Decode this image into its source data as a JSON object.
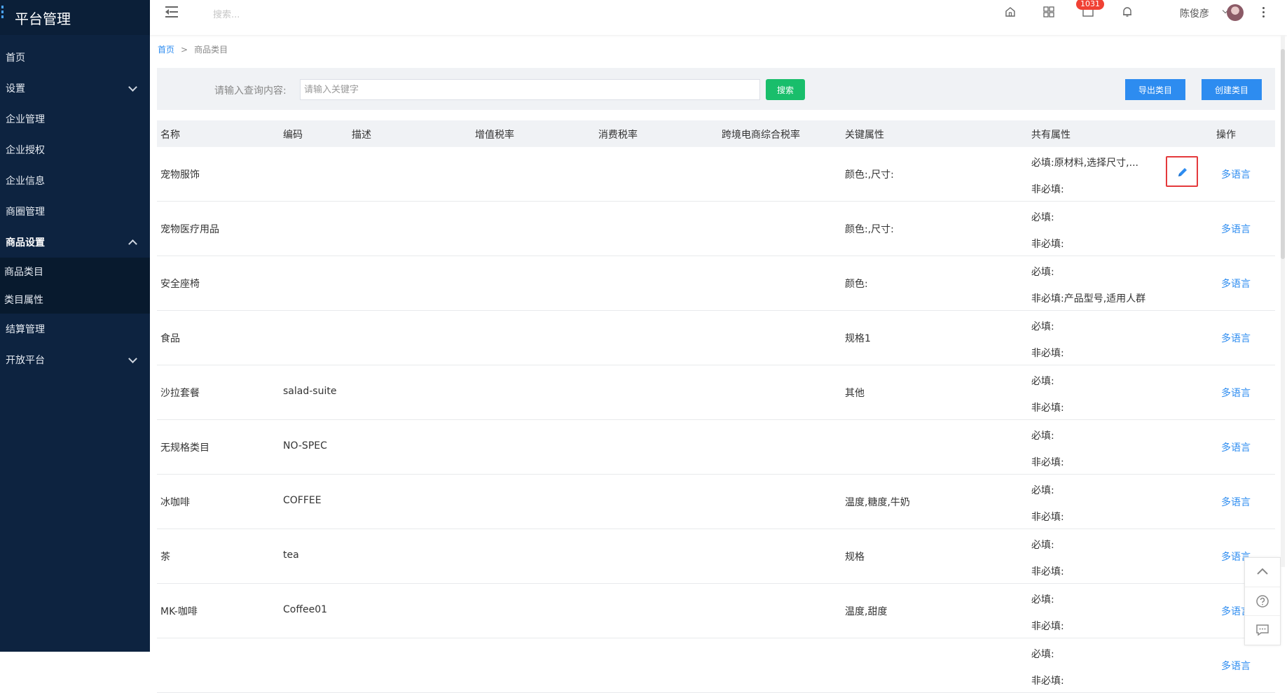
{
  "app": {
    "title": "平台管理"
  },
  "sidebar": {
    "items": [
      {
        "label": "首页"
      },
      {
        "label": "设置"
      },
      {
        "label": "企业管理"
      },
      {
        "label": "企业授权"
      },
      {
        "label": "企业信息"
      },
      {
        "label": "商圈管理"
      },
      {
        "label": "商品设置"
      },
      {
        "label": "结算管理"
      },
      {
        "label": "开放平台"
      }
    ],
    "sub_items": [
      {
        "label": "商品类目"
      },
      {
        "label": "类目属性"
      }
    ]
  },
  "topbar": {
    "search_placeholder": "搜索...",
    "badge_count": "1031",
    "user_name": "陈俊彦"
  },
  "breadcrumb": {
    "home": "首页",
    "separator": ">",
    "current": "商品类目"
  },
  "filter": {
    "label": "请输入查询内容:",
    "placeholder": "请输入关键字",
    "search_label": "搜索",
    "export_label": "导出类目",
    "create_label": "创建类目"
  },
  "table": {
    "headers": {
      "name": "名称",
      "code": "编码",
      "desc": "描述",
      "vat": "增值税率",
      "consumption": "消费税率",
      "crossborder": "跨境电商综合税率",
      "key_attr": "关键属性",
      "shared_attr": "共有属性",
      "action": "操作"
    },
    "required_label": "必填:",
    "optional_label": "非必填:",
    "action_label": "多语言",
    "rows": [
      {
        "name": "宠物服饰",
        "code": "",
        "key_attr": "颜色:,尺寸:",
        "required": "原材料,选择尺寸,...",
        "optional": ""
      },
      {
        "name": "宠物医疗用品",
        "code": "",
        "key_attr": "颜色:,尺寸:",
        "required": "",
        "optional": ""
      },
      {
        "name": "安全座椅",
        "code": "",
        "key_attr": "颜色:",
        "required": "",
        "optional": "产品型号,适用人群"
      },
      {
        "name": "食品",
        "code": "",
        "key_attr": "规格1",
        "required": "",
        "optional": ""
      },
      {
        "name": "沙拉套餐",
        "code": "salad-suite",
        "key_attr": "其他",
        "required": "",
        "optional": ""
      },
      {
        "name": "无规格类目",
        "code": "NO-SPEC",
        "key_attr": "",
        "required": "",
        "optional": ""
      },
      {
        "name": "冰咖啡",
        "code": "COFFEE",
        "key_attr": "温度,糖度,牛奶",
        "required": "",
        "optional": ""
      },
      {
        "name": "茶",
        "code": "tea",
        "key_attr": "规格",
        "required": "",
        "optional": ""
      },
      {
        "name": "MK-咖啡",
        "code": "Coffee01",
        "key_attr": "温度,甜度",
        "required": "",
        "optional": ""
      },
      {
        "name": "",
        "code": "",
        "key_attr": "",
        "required": "",
        "optional": ""
      }
    ]
  },
  "icons": {
    "menu": "menu-fold-icon",
    "home": "home-icon",
    "apps": "apps-grid-icon",
    "message": "message-icon",
    "bell": "bell-icon",
    "more": "more-vertical-icon",
    "edit": "edit-pencil-icon",
    "back_top": "chevron-up-icon",
    "help": "help-circle-icon",
    "feedback": "chat-icon"
  },
  "colors": {
    "sidebar": "#0d2340",
    "accent": "#2d8cf0",
    "success": "#19be6b",
    "danger": "#e4393c",
    "badge": "#f04134"
  }
}
